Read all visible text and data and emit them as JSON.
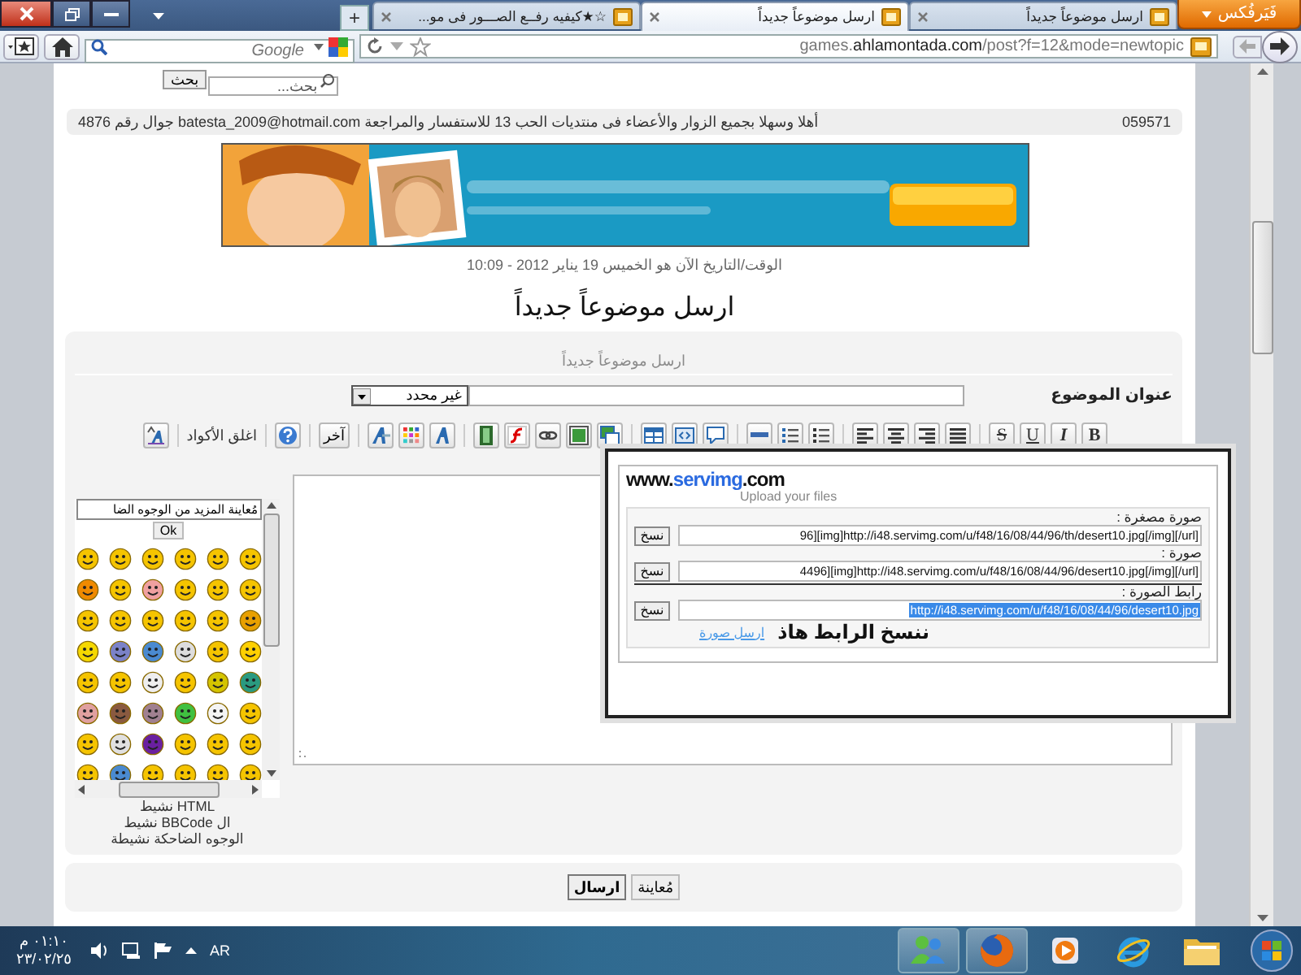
{
  "browser": {
    "firefox_button": "فَيَرفُكس",
    "tabs": [
      {
        "title": "ارسل موضوعاً جديداً",
        "selected": false
      },
      {
        "title": "ارسل موضوعاً جديداً",
        "selected": true
      },
      {
        "title": "☆★كيفيه رفــع الصـــور فى مو...",
        "selected": false
      }
    ],
    "new_tab": "+",
    "search_placeholder": "Google",
    "url": "games.**ahlamontada.com**/post?f=12&mode=newtopic"
  },
  "page": {
    "search": {
      "placeholder": "بحث...",
      "button": "بحث"
    },
    "info_bar": {
      "code": "059571",
      "message": "أهلا وسهلا بجميع الزوار والأعضاء فى منتديات الحب 13 للاستفسار والمراجعة batesta_2009@hotmail.com جوال رقم 4876"
    },
    "datetime": "الوقت/التاريخ الآن هو الخميس 19 يناير 2012 - 10:09",
    "heading": "ارسل موضوعاً جديداً",
    "form": {
      "header": "ارسل موضوعاً جديداً",
      "subject_label": "عنوان الموضوع",
      "category": "غير محدد",
      "toolbar": {
        "format_buttons": [
          "B",
          "I",
          "U",
          "S"
        ],
        "other_button": "آخر",
        "close_codes": "اغلق الأكواد"
      },
      "smilies": {
        "more": "مُعاينة المزيد من الوجوه الضا",
        "ok": "Ok"
      },
      "status": [
        "HTML نشيط",
        "ال BBCode نشيط",
        "الوجوه الضاحكة نشيطة"
      ]
    },
    "buttons": [
      {
        "label": "مُعاينة",
        "primary": false
      },
      {
        "label": "ارسال",
        "primary": true
      }
    ]
  },
  "popup": {
    "logo": {
      "prefix": "www.",
      "name": "servimg",
      "suffix": ".com"
    },
    "tagline": "Upload your files",
    "fields": [
      {
        "label": "صورة مصغرة :",
        "value": "96][img]http://i48.servimg.com/u/f48/16/08/44/96/th/desert10.jpg[/img][/url]",
        "button": "نسخ",
        "selected": false
      },
      {
        "label": "صورة :",
        "value": "4496][img]http://i48.servimg.com/u/f48/16/08/44/96/desert10.jpg[/img][/url]",
        "button": "نسخ",
        "selected": false
      },
      {
        "label": "رابط الصورة :",
        "value": "http://i48.servimg.com/u/f48/16/08/44/96/desert10.jpg",
        "button": "نسخ",
        "selected": true
      }
    ],
    "link": "ارسل صورة",
    "note": "ننسخ الرابط هاذ"
  },
  "taskbar": {
    "time": "٠١:١٠ م",
    "date": "٢٣/٠٢/٢٥",
    "language": "AR",
    "apps": [
      {
        "running": true
      },
      {
        "running": true
      },
      {
        "running": false
      },
      {
        "running": false
      },
      {
        "running": false
      }
    ]
  }
}
